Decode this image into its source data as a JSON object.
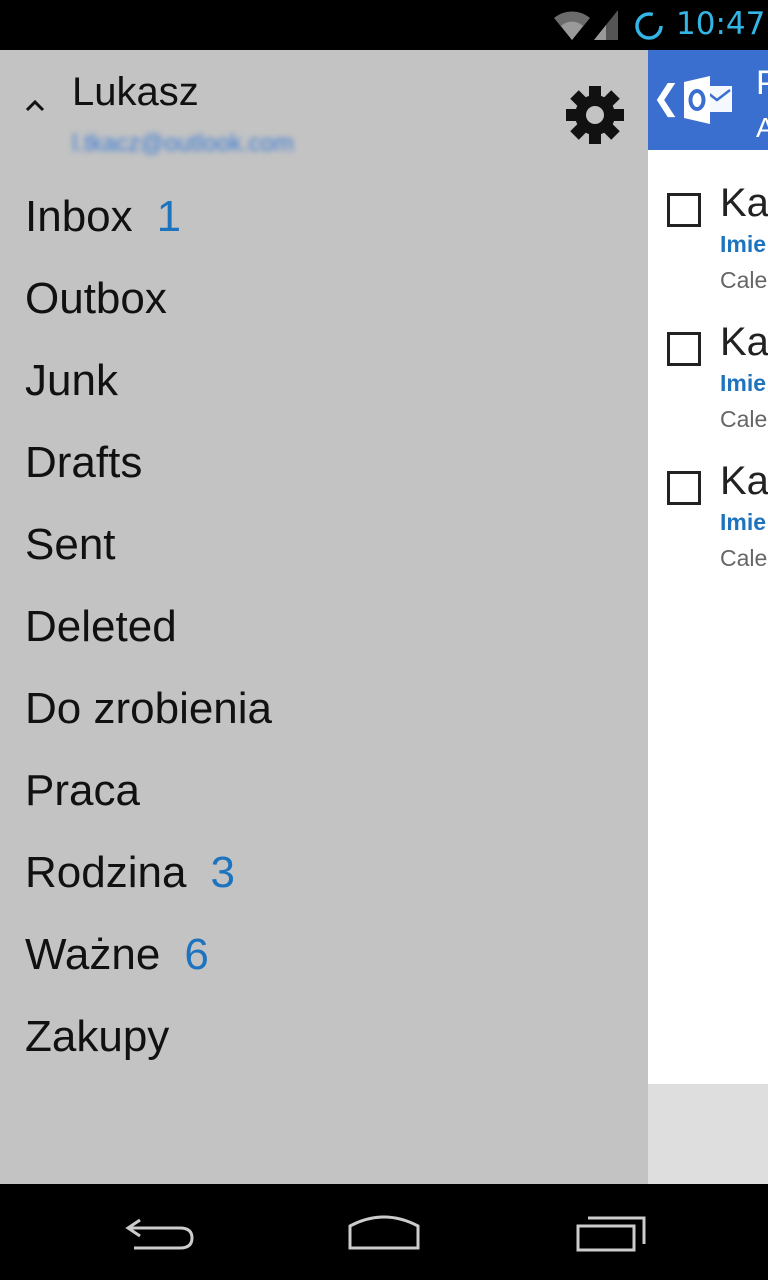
{
  "status_bar": {
    "time": "10:47",
    "icons": [
      "wifi-icon",
      "signal-icon",
      "sync-icon"
    ]
  },
  "drawer": {
    "account_name": "Lukasz",
    "account_email": "l.tkacz@outlook.com",
    "folders": [
      {
        "label": "Inbox",
        "count": "1"
      },
      {
        "label": "Outbox",
        "count": ""
      },
      {
        "label": "Junk",
        "count": ""
      },
      {
        "label": "Drafts",
        "count": ""
      },
      {
        "label": "Sent",
        "count": ""
      },
      {
        "label": "Deleted",
        "count": ""
      },
      {
        "label": "Do zrobienia",
        "count": ""
      },
      {
        "label": "Praca",
        "count": ""
      },
      {
        "label": "Rodzina",
        "count": "3"
      },
      {
        "label": "Ważne",
        "count": "6"
      },
      {
        "label": "Zakupy",
        "count": ""
      }
    ]
  },
  "content": {
    "header_title": "P",
    "header_sub": "A",
    "tasks": [
      {
        "title": "Ka",
        "list": "Imie",
        "meta": "Cale"
      },
      {
        "title": "Ka",
        "list": "Imie",
        "meta": "Cale"
      },
      {
        "title": "Ka",
        "list": "Imie",
        "meta": "Cale"
      }
    ]
  },
  "colors": {
    "accent": "#1e73be",
    "header": "#3b6fcf",
    "drawer_bg": "#c3c3c3",
    "status_clock": "#33b5e5"
  }
}
